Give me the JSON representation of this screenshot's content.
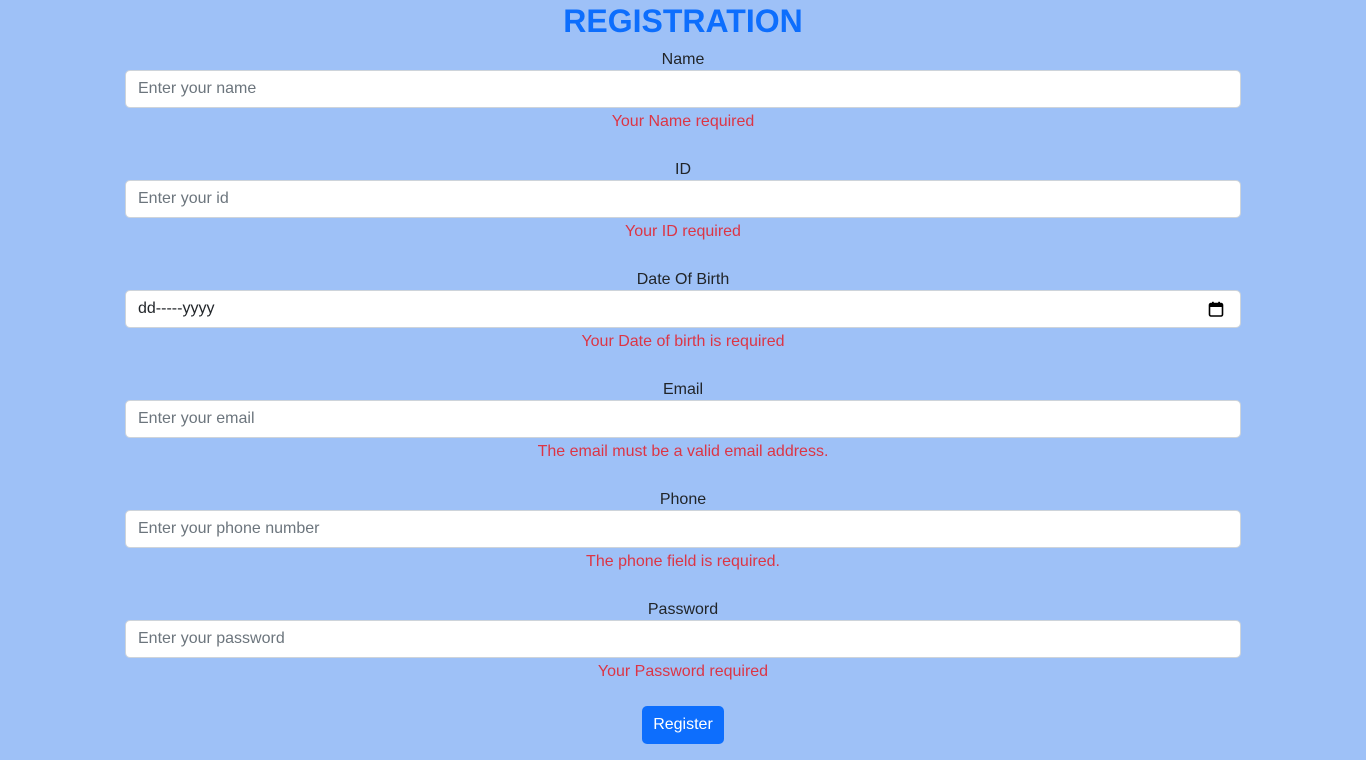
{
  "title": "REGISTRATION",
  "fields": [
    {
      "label": "Name",
      "placeholder": "Enter your name",
      "error": "Your Name required"
    },
    {
      "label": "ID",
      "placeholder": "Enter your id",
      "error": "Your ID required"
    },
    {
      "label": "Date Of Birth",
      "value": "dd-----yyyy",
      "error": "Your Date of birth is required"
    },
    {
      "label": "Email",
      "placeholder": "Enter your email",
      "error": "The email must be a valid email address."
    },
    {
      "label": "Phone",
      "placeholder": "Enter your phone number",
      "error": "The phone field is required."
    },
    {
      "label": "Password",
      "placeholder": "Enter your password",
      "error": "Your Password required"
    }
  ],
  "register_label": "Register",
  "colors": {
    "background": "#9ec1f7",
    "accent": "#0d6efd",
    "error": "#dc3545"
  }
}
